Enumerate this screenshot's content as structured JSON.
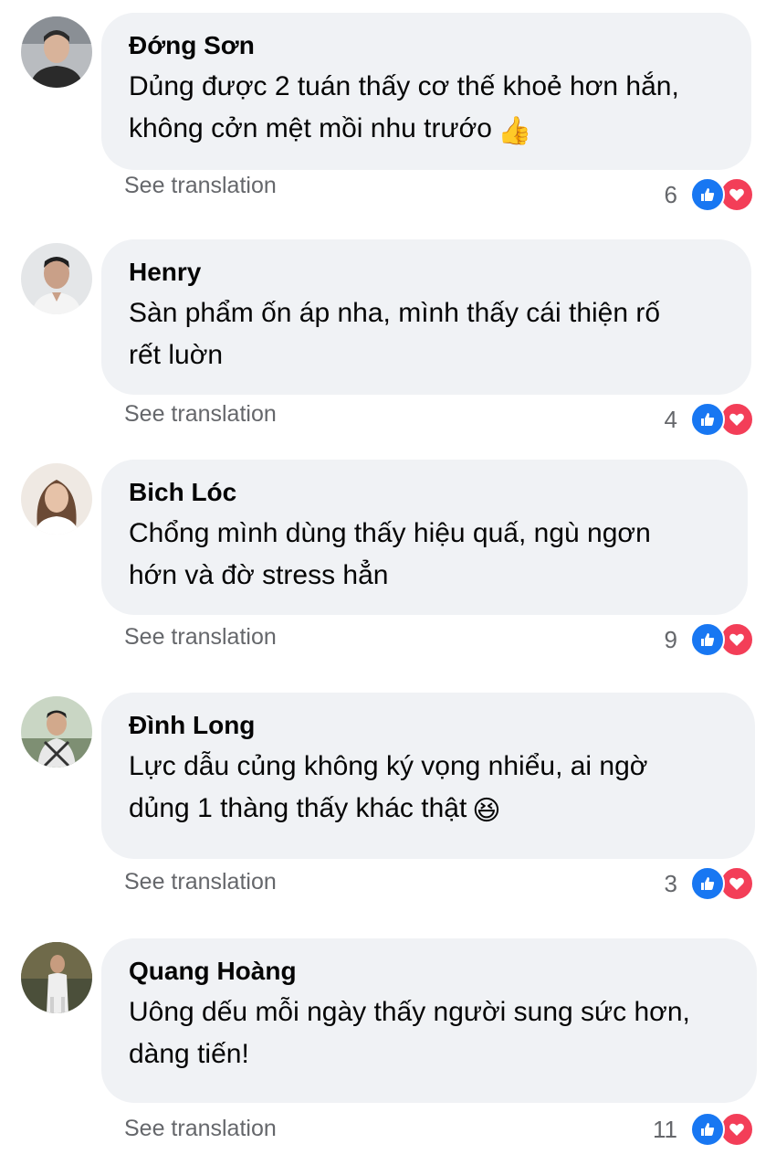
{
  "colors": {
    "bubble": "#f0f2f5",
    "like": "#1877f2",
    "love": "#f33e58",
    "secondary_text": "#65676b"
  },
  "comments": [
    {
      "author": "Đớng Sơn",
      "lines": [
        "Dủng được 2 tuán thấy cơ thế khoẻ hơn hắn,",
        "không cởn mệt mồi nhu trướo"
      ],
      "emoji": "👍",
      "see_translation": "See translation",
      "reaction_count": "6",
      "reactions": [
        "like-icon",
        "love-icon"
      ]
    },
    {
      "author": "Henry",
      "lines": [
        "Sàn phẩm ốn áp nha, mình thấy cái thiện rố",
        "rết luờn"
      ],
      "emoji": "",
      "see_translation": "See translation",
      "reaction_count": "4",
      "reactions": [
        "like-icon",
        "love-icon"
      ]
    },
    {
      "author": "Bich Lóc",
      "lines": [
        "Chổng mình dùng thấy hiệu quấ, ngù ngơn",
        "hớn và đờ stress hẳn"
      ],
      "emoji": "",
      "see_translation": "See translation",
      "reaction_count": "9",
      "reactions": [
        "like-icon",
        "love-icon"
      ]
    },
    {
      "author": "Đình Long",
      "lines": [
        "Lực dẫu củng không ký vọng nhiểu, ai ngờ",
        "dủng 1 thàng thấy khác thật"
      ],
      "emoji": "😆",
      "see_translation": "See translation",
      "reaction_count": "3",
      "reactions": [
        "like-icon",
        "love-icon"
      ]
    },
    {
      "author": "Quang Hoàng",
      "lines": [
        "Uông dếu mỗi ngày thấy người sung sức hơn,",
        "dàng tiến!"
      ],
      "emoji": "",
      "see_translation": "See translation",
      "reaction_count": "11",
      "reactions": [
        "like-icon",
        "love-icon"
      ]
    }
  ]
}
